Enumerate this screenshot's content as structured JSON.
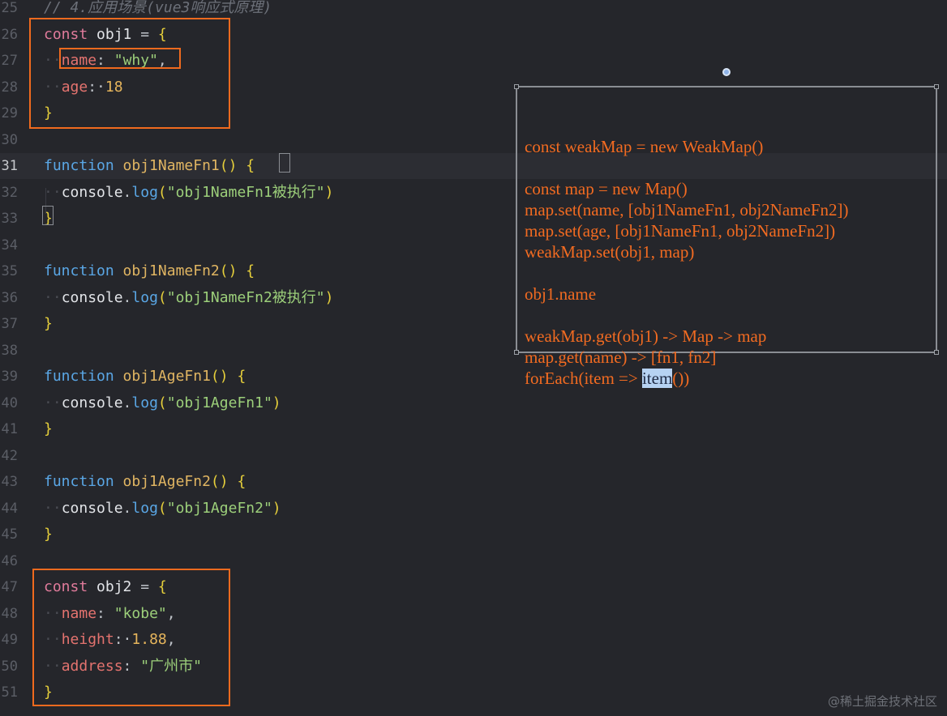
{
  "editor": {
    "lines": [
      {
        "n": "25",
        "tokens": [
          {
            "t": "// 4.应用场景(vue3响应式原理)",
            "c": "cmt"
          }
        ]
      },
      {
        "n": "26",
        "tokens": [
          {
            "t": "const ",
            "c": "kw"
          },
          {
            "t": "obj1",
            "c": "ident"
          },
          {
            "t": " = ",
            "c": "pun"
          },
          {
            "t": "{",
            "c": "brc"
          }
        ]
      },
      {
        "n": "27",
        "tokens": [
          {
            "t": "··",
            "c": "dot-ws"
          },
          {
            "t": "name",
            "c": "prop"
          },
          {
            "t": ": ",
            "c": "pun"
          },
          {
            "t": "\"why\"",
            "c": "str"
          },
          {
            "t": ",",
            "c": "pun"
          }
        ]
      },
      {
        "n": "28",
        "tokens": [
          {
            "t": "··",
            "c": "dot-ws"
          },
          {
            "t": "age",
            "c": "prop"
          },
          {
            "t": ":·",
            "c": "pun"
          },
          {
            "t": "18",
            "c": "num"
          }
        ]
      },
      {
        "n": "29",
        "tokens": [
          {
            "t": "}",
            "c": "brc"
          }
        ]
      },
      {
        "n": "30",
        "tokens": []
      },
      {
        "n": "31",
        "tokens": [
          {
            "t": "function ",
            "c": "blue"
          },
          {
            "t": "obj1NameFn1",
            "c": "fn"
          },
          {
            "t": "() ",
            "c": "brc"
          },
          {
            "t": "{",
            "c": "brc"
          }
        ]
      },
      {
        "n": "32",
        "tokens": [
          {
            "t": "··",
            "c": "dot-ws"
          },
          {
            "t": "console",
            "c": "ident"
          },
          {
            "t": ".",
            "c": "pun"
          },
          {
            "t": "log",
            "c": "blue"
          },
          {
            "t": "(",
            "c": "brc"
          },
          {
            "t": "\"obj1NameFn1被执行\"",
            "c": "str"
          },
          {
            "t": ")",
            "c": "brc"
          }
        ]
      },
      {
        "n": "33",
        "tokens": [
          {
            "t": "}",
            "c": "brc"
          }
        ]
      },
      {
        "n": "34",
        "tokens": []
      },
      {
        "n": "35",
        "tokens": [
          {
            "t": "function ",
            "c": "blue"
          },
          {
            "t": "obj1NameFn2",
            "c": "fn"
          },
          {
            "t": "() ",
            "c": "brc"
          },
          {
            "t": "{",
            "c": "brc"
          }
        ]
      },
      {
        "n": "36",
        "tokens": [
          {
            "t": "··",
            "c": "dot-ws"
          },
          {
            "t": "console",
            "c": "ident"
          },
          {
            "t": ".",
            "c": "pun"
          },
          {
            "t": "log",
            "c": "blue"
          },
          {
            "t": "(",
            "c": "brc"
          },
          {
            "t": "\"obj1NameFn2被执行\"",
            "c": "str"
          },
          {
            "t": ")",
            "c": "brc"
          }
        ]
      },
      {
        "n": "37",
        "tokens": [
          {
            "t": "}",
            "c": "brc"
          }
        ]
      },
      {
        "n": "38",
        "tokens": []
      },
      {
        "n": "39",
        "tokens": [
          {
            "t": "function ",
            "c": "blue"
          },
          {
            "t": "obj1AgeFn1",
            "c": "fn"
          },
          {
            "t": "() ",
            "c": "brc"
          },
          {
            "t": "{",
            "c": "brc"
          }
        ]
      },
      {
        "n": "40",
        "tokens": [
          {
            "t": "··",
            "c": "dot-ws"
          },
          {
            "t": "console",
            "c": "ident"
          },
          {
            "t": ".",
            "c": "pun"
          },
          {
            "t": "log",
            "c": "blue"
          },
          {
            "t": "(",
            "c": "brc"
          },
          {
            "t": "\"obj1AgeFn1\"",
            "c": "str"
          },
          {
            "t": ")",
            "c": "brc"
          }
        ]
      },
      {
        "n": "41",
        "tokens": [
          {
            "t": "}",
            "c": "brc"
          }
        ]
      },
      {
        "n": "42",
        "tokens": []
      },
      {
        "n": "43",
        "tokens": [
          {
            "t": "function ",
            "c": "blue"
          },
          {
            "t": "obj1AgeFn2",
            "c": "fn"
          },
          {
            "t": "() ",
            "c": "brc"
          },
          {
            "t": "{",
            "c": "brc"
          }
        ]
      },
      {
        "n": "44",
        "tokens": [
          {
            "t": "··",
            "c": "dot-ws"
          },
          {
            "t": "console",
            "c": "ident"
          },
          {
            "t": ".",
            "c": "pun"
          },
          {
            "t": "log",
            "c": "blue"
          },
          {
            "t": "(",
            "c": "brc"
          },
          {
            "t": "\"obj1AgeFn2\"",
            "c": "str"
          },
          {
            "t": ")",
            "c": "brc"
          }
        ]
      },
      {
        "n": "45",
        "tokens": [
          {
            "t": "}",
            "c": "brc"
          }
        ]
      },
      {
        "n": "46",
        "tokens": []
      },
      {
        "n": "47",
        "tokens": [
          {
            "t": "const ",
            "c": "kw"
          },
          {
            "t": "obj2",
            "c": "ident"
          },
          {
            "t": " = ",
            "c": "pun"
          },
          {
            "t": "{",
            "c": "brc"
          }
        ]
      },
      {
        "n": "48",
        "tokens": [
          {
            "t": "··",
            "c": "dot-ws"
          },
          {
            "t": "name",
            "c": "prop"
          },
          {
            "t": ": ",
            "c": "pun"
          },
          {
            "t": "\"kobe\"",
            "c": "str"
          },
          {
            "t": ",",
            "c": "pun"
          }
        ]
      },
      {
        "n": "49",
        "tokens": [
          {
            "t": "··",
            "c": "dot-ws"
          },
          {
            "t": "height",
            "c": "prop"
          },
          {
            "t": ":·",
            "c": "pun"
          },
          {
            "t": "1.88",
            "c": "num"
          },
          {
            "t": ",",
            "c": "pun"
          }
        ]
      },
      {
        "n": "50",
        "tokens": [
          {
            "t": "··",
            "c": "dot-ws"
          },
          {
            "t": "address",
            "c": "prop"
          },
          {
            "t": ": ",
            "c": "pun"
          },
          {
            "t": "\"广州市\"",
            "c": "str"
          }
        ]
      },
      {
        "n": "51",
        "tokens": [
          {
            "t": "}",
            "c": "brc"
          }
        ]
      }
    ]
  },
  "note": {
    "lines": [
      "const weakMap = new WeakMap()",
      "",
      "const map = new Map()",
      "map.set(name, [obj1NameFn1, obj2NameFn2])",
      "map.set(age, [obj1NameFn1, obj2NameFn2])",
      "weakMap.set(obj1, map)",
      "",
      "obj1.name",
      "",
      "weakMap.get(obj1) -> Map -> map",
      "map.get(name) -> [fn1, fn2]"
    ],
    "last_line": {
      "before": "forEach(item => ",
      "selected": "item",
      "after": "())"
    }
  },
  "watermark": "@稀土掘金技术社区",
  "colors": {
    "background": "#25262b",
    "highlight_box": "#f06a1e",
    "note_text": "#f26b21",
    "selection": "#b6d2f2"
  }
}
